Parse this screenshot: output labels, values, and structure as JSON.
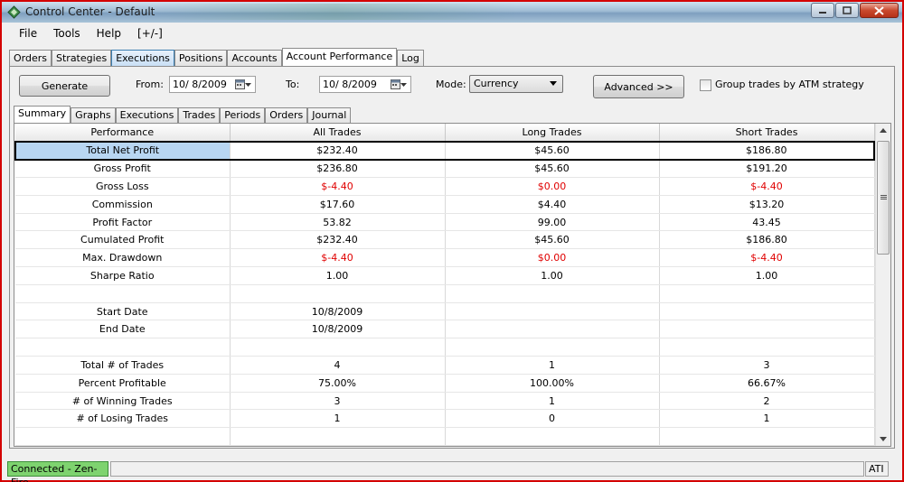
{
  "window": {
    "title": "Control Center - Default"
  },
  "menu": [
    "File",
    "Tools",
    "Help",
    "[+/-]"
  ],
  "main_tabs": [
    "Orders",
    "Strategies",
    "Executions",
    "Positions",
    "Accounts",
    "Account Performance",
    "Log"
  ],
  "toolbar": {
    "generate_label": "Generate",
    "from_label": "From:",
    "from_value": "10/  8/2009",
    "to_label": "To:",
    "to_value": "10/  8/2009",
    "mode_label": "Mode:",
    "mode_value": "Currency",
    "advanced_label": "Advanced >>",
    "group_label": "Group trades by ATM strategy"
  },
  "sub_tabs": [
    "Summary",
    "Graphs",
    "Executions",
    "Trades",
    "Periods",
    "Orders",
    "Journal"
  ],
  "table": {
    "headers": [
      "Performance",
      "All Trades",
      "Long Trades",
      "Short Trades"
    ],
    "rows": [
      [
        "Total Net Profit",
        "$232.40",
        "$45.60",
        "$186.80"
      ],
      [
        "Gross Profit",
        "$236.80",
        "$45.60",
        "$191.20"
      ],
      [
        "Gross Loss",
        "$-4.40",
        "$0.00",
        "$-4.40"
      ],
      [
        "Commission",
        "$17.60",
        "$4.40",
        "$13.20"
      ],
      [
        "Profit Factor",
        "53.82",
        "99.00",
        "43.45"
      ],
      [
        "Cumulated Profit",
        "$232.40",
        "$45.60",
        "$186.80"
      ],
      [
        "Max. Drawdown",
        "$-4.40",
        "$0.00",
        "$-4.40"
      ],
      [
        "Sharpe Ratio",
        "1.00",
        "1.00",
        "1.00"
      ],
      [
        "",
        "",
        "",
        ""
      ],
      [
        "Start Date",
        "10/8/2009",
        "",
        ""
      ],
      [
        "End Date",
        "10/8/2009",
        "",
        ""
      ],
      [
        "",
        "",
        "",
        ""
      ],
      [
        "Total # of Trades",
        "4",
        "1",
        "3"
      ],
      [
        "Percent Profitable",
        "75.00%",
        "100.00%",
        "66.67%"
      ],
      [
        "# of Winning Trades",
        "3",
        "1",
        "2"
      ],
      [
        "# of Losing Trades",
        "1",
        "0",
        "1"
      ],
      [
        "",
        "",
        "",
        ""
      ]
    ]
  },
  "status": {
    "connection": "Connected - Zen-Fire",
    "right": "ATI"
  },
  "colors": {
    "negative": "#e00000",
    "connected": "#7ed36f",
    "selected_row": "#b8d6f2"
  }
}
